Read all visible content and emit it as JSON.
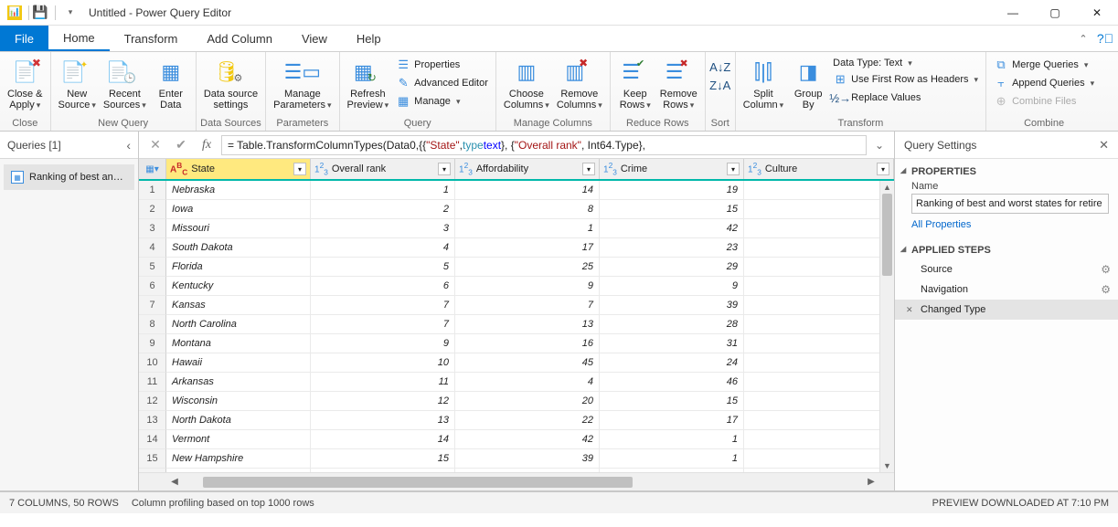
{
  "title": "Untitled - Power Query Editor",
  "menu": {
    "file": "File",
    "home": "Home",
    "transform": "Transform",
    "addColumn": "Add Column",
    "view": "View",
    "help": "Help"
  },
  "ribbon": {
    "close": {
      "closeApply": "Close &\nApply",
      "group": "Close"
    },
    "newquery": {
      "newSource": "New\nSource",
      "recentSources": "Recent\nSources",
      "enterData": "Enter\nData",
      "group": "New Query"
    },
    "dataSources": {
      "settings": "Data source\nsettings",
      "group": "Data Sources"
    },
    "parameters": {
      "manage": "Manage\nParameters",
      "group": "Parameters"
    },
    "query": {
      "refresh": "Refresh\nPreview",
      "properties": "Properties",
      "advanced": "Advanced Editor",
      "manage": "Manage",
      "group": "Query"
    },
    "managecols": {
      "choose": "Choose\nColumns",
      "remove": "Remove\nColumns",
      "group": "Manage Columns"
    },
    "reducerows": {
      "keep": "Keep\nRows",
      "removeRows": "Remove\nRows",
      "group": "Reduce Rows"
    },
    "sort": {
      "group": "Sort"
    },
    "transform": {
      "split": "Split\nColumn",
      "groupBy": "Group\nBy",
      "datatype": "Data Type: Text",
      "firstrow": "Use First Row as Headers",
      "replace": "Replace Values",
      "group": "Transform"
    },
    "combine": {
      "merge": "Merge Queries",
      "append": "Append Queries",
      "combineFiles": "Combine Files",
      "group": "Combine"
    }
  },
  "queries": {
    "title": "Queries [1]",
    "item1": "Ranking of best an…"
  },
  "formula": {
    "prefix": "= Table.TransformColumnTypes(Data0,{{",
    "state": "\"State\"",
    "mid1": ", ",
    "typekw": "type ",
    "textkw": "text",
    "mid2": "}, {",
    "orank": "\"Overall rank\"",
    "mid3": ", Int64.Type},"
  },
  "columns": {
    "state": "State",
    "rank": "Overall rank",
    "aff": "Affordability",
    "crime": "Crime",
    "culture": "Culture"
  },
  "settings": {
    "title": "Query Settings",
    "properties": "PROPERTIES",
    "nameLabel": "Name",
    "nameValue": "Ranking of best and worst states for retire",
    "allProps": "All Properties",
    "appliedSteps": "APPLIED STEPS",
    "step1": "Source",
    "step2": "Navigation",
    "step3": "Changed Type"
  },
  "status": {
    "cols": "7 COLUMNS, 50 ROWS",
    "profiling": "Column profiling based on top 1000 rows",
    "preview": "PREVIEW DOWNLOADED AT 7:10 PM"
  },
  "chart_data": {
    "type": "table",
    "columns": [
      "State",
      "Overall rank",
      "Affordability",
      "Crime",
      "Culture"
    ],
    "rows": [
      [
        "Nebraska",
        1,
        14,
        19,
        null
      ],
      [
        "Iowa",
        2,
        8,
        15,
        null
      ],
      [
        "Missouri",
        3,
        1,
        42,
        null
      ],
      [
        "South Dakota",
        4,
        17,
        23,
        null
      ],
      [
        "Florida",
        5,
        25,
        29,
        null
      ],
      [
        "Kentucky",
        6,
        9,
        9,
        null
      ],
      [
        "Kansas",
        7,
        7,
        39,
        null
      ],
      [
        "North Carolina",
        7,
        13,
        28,
        null
      ],
      [
        "Montana",
        9,
        16,
        31,
        null
      ],
      [
        "Hawaii",
        10,
        45,
        24,
        null
      ],
      [
        "Arkansas",
        11,
        4,
        46,
        null
      ],
      [
        "Wisconsin",
        12,
        20,
        15,
        null
      ],
      [
        "North Dakota",
        13,
        22,
        17,
        null
      ],
      [
        "Vermont",
        14,
        42,
        1,
        null
      ],
      [
        "New Hampshire",
        15,
        39,
        1,
        null
      ]
    ]
  }
}
